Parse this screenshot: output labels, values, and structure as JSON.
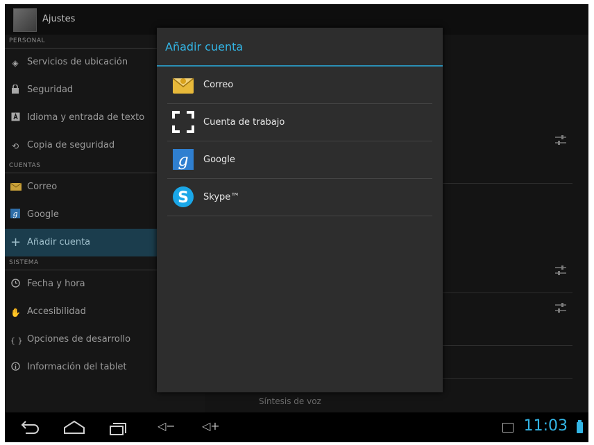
{
  "app": {
    "title": "Ajustes"
  },
  "sections": {
    "personal": "PERSONAL",
    "cuentas": "CUENTAS",
    "sistema": "SISTEMA"
  },
  "personal_items": [
    {
      "label": "Servicios de ubicación",
      "icon": "location-icon"
    },
    {
      "label": "Seguridad",
      "icon": "lock-icon"
    },
    {
      "label": "Idioma y entrada de texto",
      "icon": "keyboard-icon"
    },
    {
      "label": "Copia de seguridad",
      "icon": "backup-icon"
    }
  ],
  "account_items": [
    {
      "label": "Correo",
      "icon": "mail-icon"
    },
    {
      "label": "Google",
      "icon": "google-icon"
    },
    {
      "label": "Añadir cuenta",
      "icon": "plus-icon"
    }
  ],
  "system_items": [
    {
      "label": "Fecha y hora",
      "icon": "clock-icon"
    },
    {
      "label": "Accesibilidad",
      "icon": "hand-icon"
    },
    {
      "label": "Opciones de desarrollo",
      "icon": "braces-icon"
    },
    {
      "label": "Información del tablet",
      "icon": "info-icon"
    }
  ],
  "right_pane": {
    "tts_label": "Síntesis de voz"
  },
  "dialog": {
    "title": "Añadir cuenta",
    "accounts": [
      {
        "label": "Correo",
        "icon": "mail-icon"
      },
      {
        "label": "Cuenta de trabajo",
        "icon": "work-account-icon"
      },
      {
        "label": "Google",
        "icon": "google-icon"
      },
      {
        "label": "Skype™",
        "icon": "skype-icon"
      }
    ]
  },
  "status": {
    "time": "11:03"
  },
  "colors": {
    "accent": "#33b5e5",
    "selected_bg": "#1b3d4d",
    "dialog_bg": "#2d2d2d"
  }
}
